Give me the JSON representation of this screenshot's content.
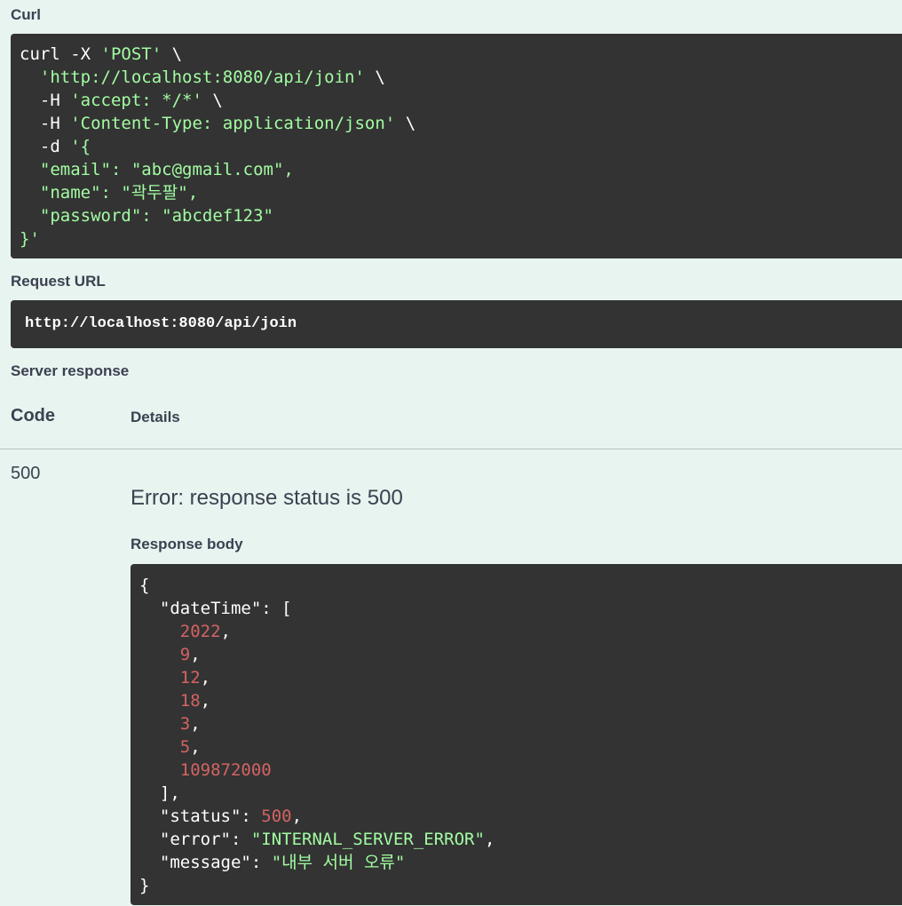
{
  "curl": {
    "label": "Curl",
    "line1_cmd": "curl -X ",
    "line1_method": "'POST'",
    "line1_cont": " \\",
    "line2_indent": "  ",
    "line2_url": "'http://localhost:8080/api/join'",
    "line2_cont": " \\",
    "line3_flag": "  -H ",
    "line3_val": "'accept: */*'",
    "line3_cont": " \\",
    "line4_flag": "  -H ",
    "line4_val": "'Content-Type: application/json'",
    "line4_cont": " \\",
    "line5_flag": "  -d ",
    "line5_val": "'{",
    "line6": "  \"email\": \"abc@gmail.com\",",
    "line7": "  \"name\": \"곽두팔\",",
    "line8": "  \"password\": \"abcdef123\"",
    "line9": "}'"
  },
  "request_url": {
    "label": "Request URL",
    "value": "http://localhost:8080/api/join"
  },
  "server_response": {
    "label": "Server response",
    "code_header": "Code",
    "details_header": "Details",
    "status_code": "500",
    "error_text": "Error: response status is 500",
    "response_body_label": "Response body"
  },
  "response_body": {
    "open_brace": "{",
    "datetime_key": "  \"dateTime\": [",
    "datetime_values": [
      "2022",
      "9",
      "12",
      "18",
      "3",
      "5",
      "109872000"
    ],
    "close_bracket": "  ],",
    "status_key": "  \"status\": ",
    "status_value": "500",
    "error_key": "  \"error\": ",
    "error_value": "\"INTERNAL_SERVER_ERROR\"",
    "message_key": "  \"message\": ",
    "message_value": "\"내부 서버 오류\"",
    "close_brace": "}"
  },
  "colors": {
    "background": "#e8f4ef",
    "code_background": "#333333",
    "string_green": "#a2fca2",
    "number_red": "#d36363"
  }
}
